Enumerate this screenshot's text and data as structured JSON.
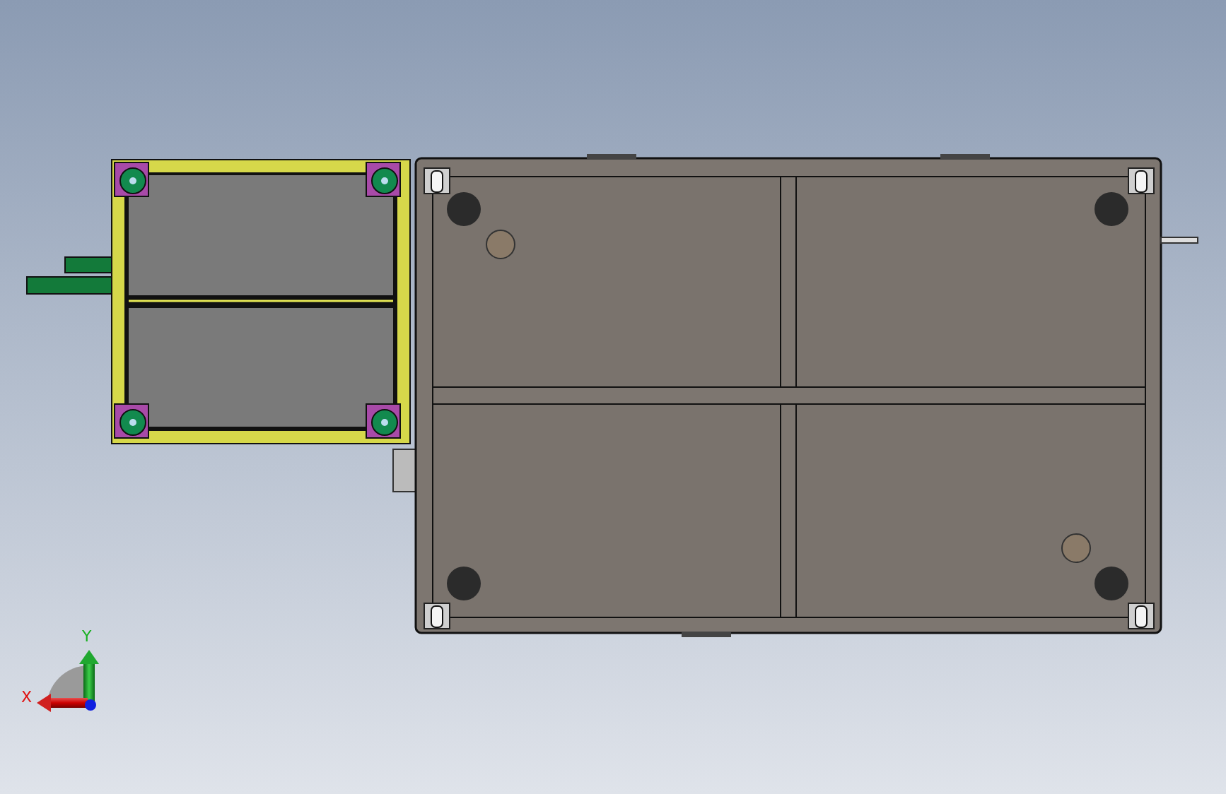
{
  "viewport": {
    "orientation_triad": {
      "x_label": "X",
      "y_label": "Y"
    }
  }
}
